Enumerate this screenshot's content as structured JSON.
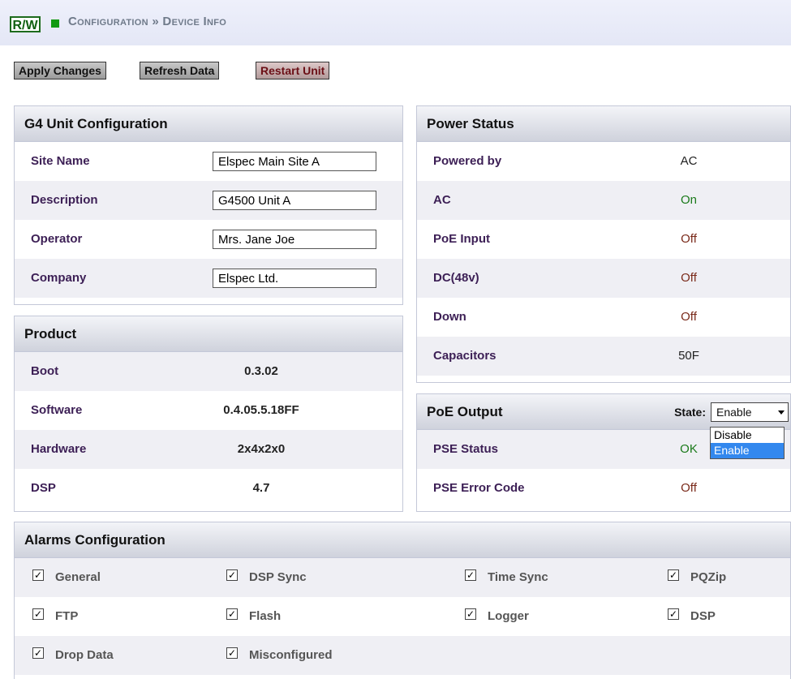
{
  "header": {
    "badge": "R/W",
    "title": "Configuration » Device Info"
  },
  "toolbar": {
    "apply_label": "Apply Changes",
    "refresh_label": "Refresh Data",
    "restart_label": "Restart Unit"
  },
  "unit_config": {
    "title": "G4 Unit Configuration",
    "rows": [
      {
        "label": "Site Name",
        "value": "Elspec Main Site A"
      },
      {
        "label": "Description",
        "value": "G4500 Unit A"
      },
      {
        "label": "Operator",
        "value": "Mrs. Jane Joe"
      },
      {
        "label": "Company",
        "value": "Elspec Ltd."
      }
    ]
  },
  "product": {
    "title": "Product",
    "rows": [
      {
        "label": "Boot",
        "value": "0.3.02"
      },
      {
        "label": "Software",
        "value": "0.4.05.5.18FF"
      },
      {
        "label": "Hardware",
        "value": "2x4x2x0"
      },
      {
        "label": "DSP",
        "value": "4.7"
      }
    ]
  },
  "power": {
    "title": "Power Status",
    "rows": [
      {
        "label": "Powered by",
        "value": "AC"
      },
      {
        "label": "AC",
        "value": "On"
      },
      {
        "label": "PoE Input",
        "value": "Off"
      },
      {
        "label": "DC(48v)",
        "value": "Off"
      },
      {
        "label": "Down",
        "value": "Off"
      },
      {
        "label": "Capacitors",
        "value": "50F"
      }
    ]
  },
  "poe_output": {
    "title": "PoE Output",
    "state_label": "State:",
    "state_value": "Enable",
    "options": [
      "Disable",
      "Enable"
    ],
    "rows": [
      {
        "label": "PSE Status",
        "value": "OK"
      },
      {
        "label": "PSE Error Code",
        "value": "Off"
      }
    ]
  },
  "alarms": {
    "title": "Alarms Configuration",
    "items": [
      {
        "label": "General",
        "checked": true
      },
      {
        "label": "DSP Sync",
        "checked": true
      },
      {
        "label": "Time Sync",
        "checked": true
      },
      {
        "label": "PQZip",
        "checked": true
      },
      {
        "label": "FTP",
        "checked": true
      },
      {
        "label": "Flash",
        "checked": true
      },
      {
        "label": "Logger",
        "checked": true
      },
      {
        "label": "DSP",
        "checked": true
      },
      {
        "label": "Drop Data",
        "checked": true
      },
      {
        "label": "Misconfigured",
        "checked": true
      }
    ]
  },
  "colors": {
    "on": "#1a7a1a",
    "off": "#7a2a1a",
    "label": "#3c1f55",
    "badge": "#116011"
  },
  "icons": {
    "checkbox_checked": "✓"
  }
}
